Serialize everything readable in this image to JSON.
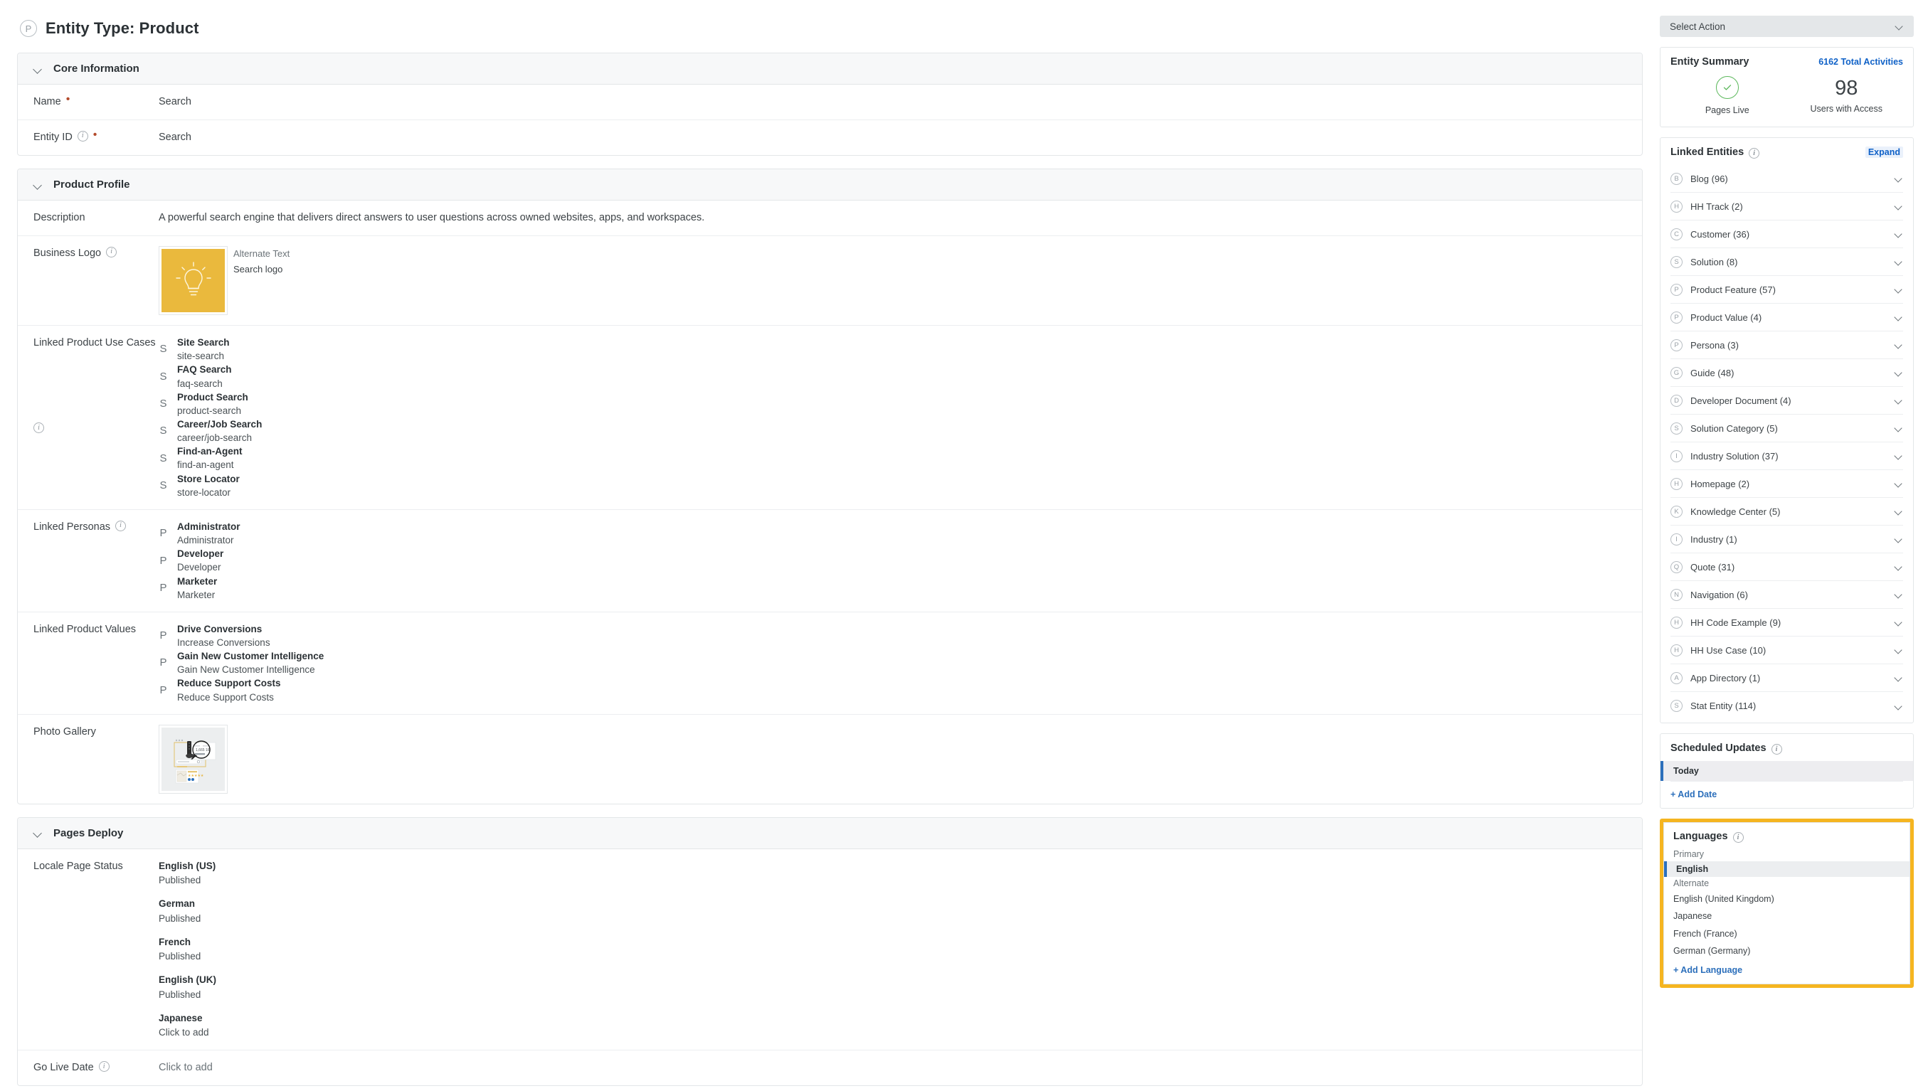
{
  "page": {
    "entity_badge": "P",
    "title": "Entity Type: Product"
  },
  "sections": {
    "core_information": {
      "title": "Core Information",
      "name_label": "Name",
      "name_value": "Search",
      "entity_id_label": "Entity ID",
      "entity_id_value": "Search"
    },
    "product_profile": {
      "title": "Product Profile",
      "description_label": "Description",
      "description_value": "A powerful search engine that delivers direct answers to user questions across owned websites, apps, and workspaces.",
      "business_logo_label": "Business Logo",
      "alternate_text_label": "Alternate Text",
      "alternate_text_value": "Search logo",
      "use_cases_label": "Linked Product Use Cases",
      "use_cases": [
        {
          "glyph": "S",
          "title": "Site Search",
          "sub": "site-search"
        },
        {
          "glyph": "S",
          "title": "FAQ Search",
          "sub": "faq-search"
        },
        {
          "glyph": "S",
          "title": "Product Search",
          "sub": "product-search"
        },
        {
          "glyph": "S",
          "title": "Career/Job Search",
          "sub": "career/job-search"
        },
        {
          "glyph": "S",
          "title": "Find-an-Agent",
          "sub": "find-an-agent"
        },
        {
          "glyph": "S",
          "title": "Store Locator",
          "sub": "store-locator"
        }
      ],
      "personas_label": "Linked Personas",
      "personas": [
        {
          "glyph": "P",
          "title": "Administrator",
          "sub": "Administrator"
        },
        {
          "glyph": "P",
          "title": "Developer",
          "sub": "Developer"
        },
        {
          "glyph": "P",
          "title": "Marketer",
          "sub": "Marketer"
        }
      ],
      "product_values_label": "Linked Product Values",
      "product_values": [
        {
          "glyph": "P",
          "title": "Drive Conversions",
          "sub": "Increase Conversions"
        },
        {
          "glyph": "P",
          "title": "Gain New Customer Intelligence",
          "sub": "Gain New Customer Intelligence"
        },
        {
          "glyph": "P",
          "title": "Reduce Support Costs",
          "sub": "Reduce Support Costs"
        }
      ],
      "photo_gallery_label": "Photo Gallery"
    },
    "pages_deploy": {
      "title": "Pages Deploy",
      "locale_page_status_label": "Locale Page Status",
      "locales": [
        {
          "name": "English (US)",
          "status": "Published"
        },
        {
          "name": "German",
          "status": "Published"
        },
        {
          "name": "French",
          "status": "Published"
        },
        {
          "name": "English (UK)",
          "status": "Published"
        },
        {
          "name": "Japanese",
          "status": "Click to add"
        }
      ],
      "go_live_date_label": "Go Live Date",
      "go_live_date_value": "Click to add"
    }
  },
  "sidebar": {
    "select_action": "Select Action",
    "entity_summary": {
      "title": "Entity Summary",
      "total_activities": "6162 Total Activities",
      "pages_live_label": "Pages Live",
      "users_count": "98",
      "users_label": "Users with Access"
    },
    "linked_entities": {
      "title": "Linked Entities",
      "expand_label": "Expand",
      "items": [
        {
          "badge": "B",
          "label": "Blog (96)"
        },
        {
          "badge": "H",
          "label": "HH Track (2)"
        },
        {
          "badge": "C",
          "label": "Customer (36)"
        },
        {
          "badge": "S",
          "label": "Solution (8)"
        },
        {
          "badge": "P",
          "label": "Product Feature (57)"
        },
        {
          "badge": "P",
          "label": "Product Value (4)"
        },
        {
          "badge": "P",
          "label": "Persona (3)"
        },
        {
          "badge": "G",
          "label": "Guide (48)"
        },
        {
          "badge": "D",
          "label": "Developer Document (4)"
        },
        {
          "badge": "S",
          "label": "Solution Category (5)"
        },
        {
          "badge": "I",
          "label": "Industry Solution (37)"
        },
        {
          "badge": "H",
          "label": "Homepage (2)"
        },
        {
          "badge": "K",
          "label": "Knowledge Center (5)"
        },
        {
          "badge": "I",
          "label": "Industry (1)"
        },
        {
          "badge": "Q",
          "label": "Quote (31)"
        },
        {
          "badge": "N",
          "label": "Navigation (6)"
        },
        {
          "badge": "H",
          "label": "HH Code Example (9)"
        },
        {
          "badge": "H",
          "label": "HH Use Case (10)"
        },
        {
          "badge": "A",
          "label": "App Directory (1)"
        },
        {
          "badge": "S",
          "label": "Stat Entity (114)"
        }
      ]
    },
    "scheduled_updates": {
      "title": "Scheduled Updates",
      "today_label": "Today",
      "add_date_label": "+ Add Date"
    },
    "languages": {
      "title": "Languages",
      "primary_group_label": "Primary",
      "primary_value": "English",
      "alternate_group_label": "Alternate",
      "alternates": [
        "English (United Kingdom)",
        "Japanese",
        "French (France)",
        "German (Germany)"
      ],
      "add_language_label": "+ Add Language"
    }
  },
  "colors": {
    "accent_blue": "#2c6fbb",
    "highlight_yellow": "#f5b520",
    "logo_amber": "#eab93d",
    "success_green": "#5cb85c"
  }
}
